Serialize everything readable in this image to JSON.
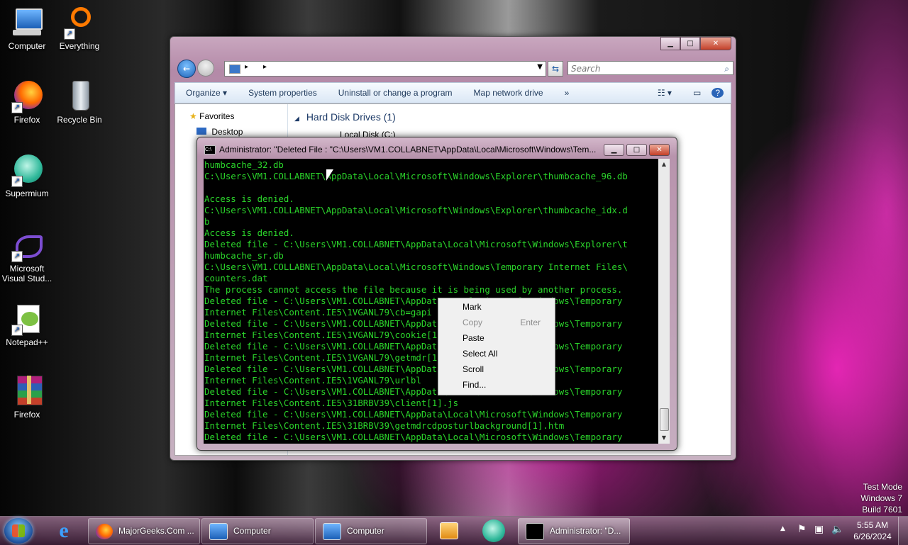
{
  "desktop": {
    "icons": [
      {
        "label": "Computer"
      },
      {
        "label": "Everything"
      },
      {
        "label": "Firefox"
      },
      {
        "label": "Recycle Bin"
      },
      {
        "label": "Supermium"
      },
      {
        "label": "Microsoft Visual Stud..."
      },
      {
        "label": "Notepad++"
      },
      {
        "label": "Firefox"
      }
    ]
  },
  "explorer": {
    "search_placeholder": "Search",
    "toolbar": {
      "organize": "Organize",
      "system_properties": "System properties",
      "uninstall": "Uninstall or change a program",
      "map_drive": "Map network drive",
      "more": "»"
    },
    "nav": {
      "favorites": "Favorites",
      "desktop": "Desktop"
    },
    "main": {
      "group_header": "Hard Disk Drives (1)",
      "drive": "Local Disk (C:)"
    }
  },
  "console": {
    "title": "Administrator:  \"Deleted File : \"C:\\Users\\VM1.COLLABNET\\AppData\\Local\\Microsoft\\Windows\\Tem...",
    "lines": [
      "humbcache_32.db",
      "C:\\Users\\VM1.COLLABNET\\AppData\\Local\\Microsoft\\Windows\\Explorer\\thumbcache_96.db",
      "",
      "Access is denied.",
      "C:\\Users\\VM1.COLLABNET\\AppData\\Local\\Microsoft\\Windows\\Explorer\\thumbcache_idx.d",
      "b",
      "Access is denied.",
      "Deleted file - C:\\Users\\VM1.COLLABNET\\AppData\\Local\\Microsoft\\Windows\\Explorer\\t",
      "humbcache_sr.db",
      "C:\\Users\\VM1.COLLABNET\\AppData\\Local\\Microsoft\\Windows\\Temporary Internet Files\\",
      "counters.dat",
      "The process cannot access the file because it is being used by another process.",
      "Deleted file - C:\\Users\\VM1.COLLABNET\\AppData\\Local\\Microsoft\\Windows\\Temporary",
      "Internet Files\\Content.IE5\\1VGANL79\\cb=gapi",
      "Deleted file - C:\\Users\\VM1.COLLABNET\\AppData\\Local\\Microsoft\\Windows\\Temporary",
      "Internet Files\\Content.IE5\\1VGANL79\\cookie[1].js",
      "Deleted file - C:\\Users\\VM1.COLLABNET\\AppData\\Local\\Microsoft\\Windows\\Temporary",
      "Internet Files\\Content.IE5\\1VGANL79\\getmdr[1].htm",
      "Deleted file - C:\\Users\\VM1.COLLABNET\\AppData\\Local\\Microsoft\\Windows\\Temporary",
      "Internet Files\\Content.IE5\\1VGANL79\\urlbl",
      "Deleted file - C:\\Users\\VM1.COLLABNET\\AppData\\Local\\Microsoft\\Windows\\Temporary",
      "Internet Files\\Content.IE5\\31BRBV39\\client[1].js",
      "Deleted file - C:\\Users\\VM1.COLLABNET\\AppData\\Local\\Microsoft\\Windows\\Temporary",
      "Internet Files\\Content.IE5\\31BRBV39\\getmdrcdposturlbackground[1].htm",
      "Deleted file - C:\\Users\\VM1.COLLABNET\\AppData\\Local\\Microsoft\\Windows\\Temporary"
    ]
  },
  "context_menu": {
    "items": [
      {
        "label": "Mark",
        "shortcut": "",
        "disabled": false
      },
      {
        "label": "Copy",
        "shortcut": "Enter",
        "disabled": true
      },
      {
        "label": "Paste",
        "shortcut": "",
        "disabled": false
      },
      {
        "label": "Select All",
        "shortcut": "",
        "disabled": false
      },
      {
        "label": "Scroll",
        "shortcut": "",
        "disabled": false
      },
      {
        "label": "Find...",
        "shortcut": "",
        "disabled": false
      }
    ]
  },
  "taskbar": {
    "buttons": [
      {
        "label": "MajorGeeks.Com ..."
      },
      {
        "label": "Computer"
      },
      {
        "label": "Computer"
      },
      {
        "label": "Administrator:  \"D..."
      }
    ],
    "clock_time": "5:55 AM",
    "clock_date": "6/26/2024"
  },
  "watermark": {
    "line1": "Test Mode",
    "line2": "Windows 7",
    "line3": "Build 7601"
  },
  "colors": {
    "terminal_text": "#2bd52b",
    "terminal_bg": "#000000",
    "accent": "#ff2ac8"
  }
}
